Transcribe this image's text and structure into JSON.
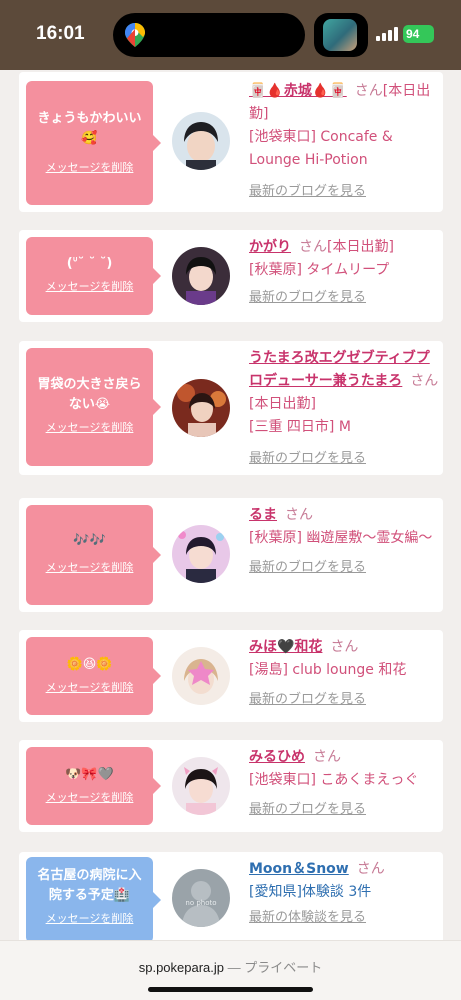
{
  "status": {
    "time": "16:01",
    "battery": "94"
  },
  "cards": [
    {
      "message": "きょうもかわいい🥰",
      "delete_label": "メッセージを削除",
      "name": "🀄🩸赤城🩸🀄",
      "san": "さん",
      "status": "[本日出勤]",
      "shop": "[池袋東口] Concafe & Lounge Hi-Potion",
      "blog": "最新のブログを見る"
    },
    {
      "message": "(ᐡ˘ ˘ ˘)",
      "delete_label": "メッセージを削除",
      "name": "かがり",
      "san": "さん",
      "status": "[本日出勤]",
      "shop": "[秋葉原] タイムリープ",
      "blog": "最新のブログを見る"
    },
    {
      "message": "胃袋の大きさ戻らない😭",
      "delete_label": "メッセージを削除",
      "name": "うたまろ改エグゼブティブプロデューサー兼うたまろ",
      "san": "さん",
      "status": "[本日出勤]",
      "shop": "[三重 四日市] M",
      "blog": "最新のブログを見る"
    },
    {
      "message": "🎶🎶",
      "delete_label": "メッセージを削除",
      "name": "るま",
      "san": "さん",
      "status": "",
      "shop": "[秋葉原] 幽遊屋敷〜霊女編〜",
      "blog": "最新のブログを見る"
    },
    {
      "message": "🌼😆🌼",
      "delete_label": "メッセージを削除",
      "name": "みほ🖤和花",
      "san": "さん",
      "status": "",
      "shop": "[湯島] club lounge 和花",
      "blog": "最新のブログを見る"
    },
    {
      "message": "🐶🎀🩶",
      "delete_label": "メッセージを削除",
      "name": "みるひめ",
      "san": "さん",
      "status": "",
      "shop": "[池袋東口] こあくまえっぐ",
      "blog": "最新のブログを見る"
    },
    {
      "message": "名古屋の病院に入院する予定🏥",
      "delete_label": "メッセージを削除",
      "name": "Moon＆Snow",
      "san": "さん",
      "status": "",
      "shop": "[愛知県]体験談 3件",
      "blog": "最新の体験談を見る",
      "avatar_text": "no photo"
    }
  ],
  "browser": {
    "domain": "sp.pokepara.jp",
    "separator": " — ",
    "mode": "プライベート"
  },
  "colors": {
    "bubble": "#f4909e",
    "bubble_alt": "#8ab6ec",
    "name": "#c8336b",
    "status_bar": "#5c4a3a"
  }
}
